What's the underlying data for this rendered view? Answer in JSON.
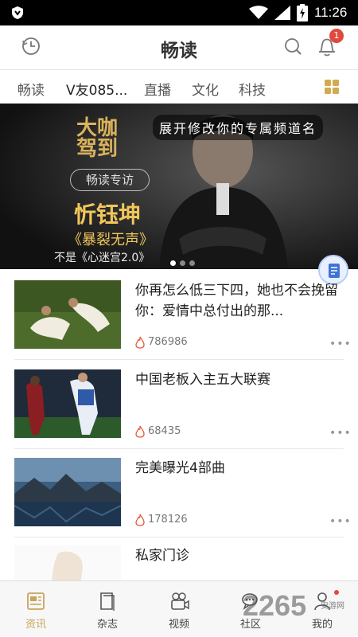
{
  "statusbar": {
    "time": "11:26"
  },
  "appbar": {
    "title": "畅读",
    "notification_count": "1"
  },
  "tabs": [
    {
      "label": "畅读"
    },
    {
      "label": "V友085..."
    },
    {
      "label": "直播"
    },
    {
      "label": "文化"
    },
    {
      "label": "科技"
    }
  ],
  "banner": {
    "slogan": "展开修改你的专属频道名",
    "logo_line1": "大咖",
    "logo_line2": "驾到",
    "tag": "畅读专访",
    "name": "忻钰坤",
    "sub1": "《暴裂无声》",
    "sub2": "不是《心迷宫2.0》",
    "slide_count": 3,
    "active_slide": 0
  },
  "articles": [
    {
      "headline": "你再怎么低三下四，她也不会挽留你：爱情中总付出的那...",
      "count": "786986"
    },
    {
      "headline": "中国老板入主五大联赛",
      "count": "68435"
    },
    {
      "headline": "完美曝光4部曲",
      "count": "178126"
    },
    {
      "headline": "私家门诊",
      "count": ""
    }
  ],
  "bottomnav": [
    {
      "label": "资讯",
      "icon": "news-icon"
    },
    {
      "label": "杂志",
      "icon": "magazine-icon"
    },
    {
      "label": "视频",
      "icon": "video-icon"
    },
    {
      "label": "社区",
      "icon": "community-icon"
    },
    {
      "label": "我的",
      "icon": "profile-icon"
    }
  ],
  "watermark": {
    "text": "2265",
    "sub": "安游网"
  },
  "colors": {
    "accent": "#c9a45a",
    "badge": "#e04a3c",
    "fire": "#e35b3a"
  }
}
